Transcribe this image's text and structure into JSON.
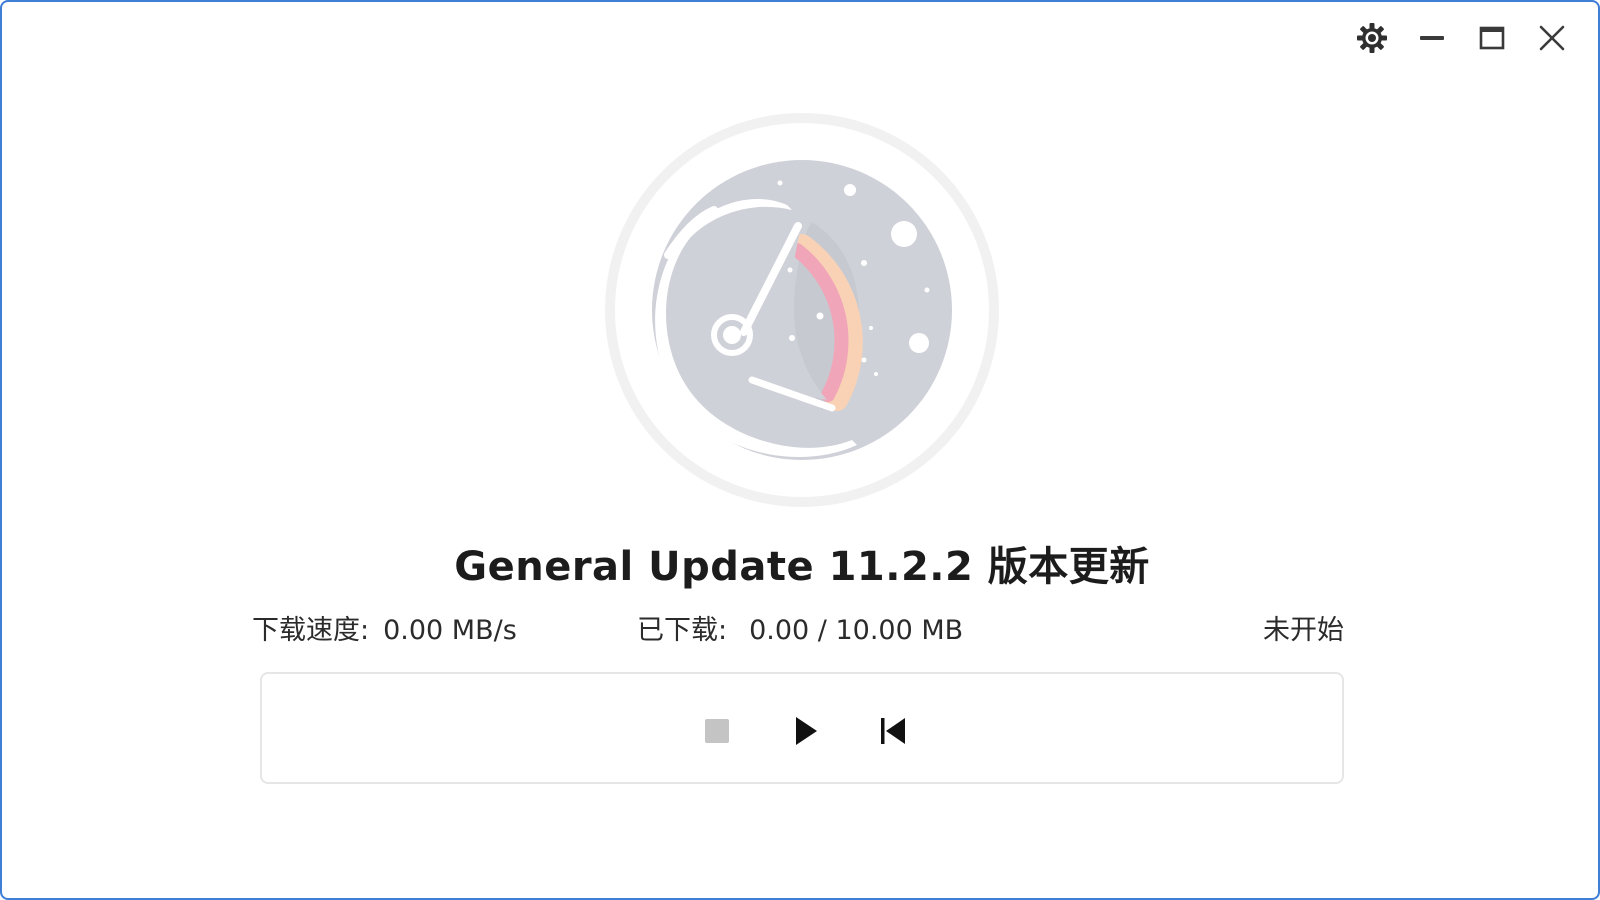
{
  "window": {
    "controls": {
      "settings_icon": "gear-icon",
      "minimize_icon": "minimize-icon",
      "maximize_icon": "maximize-icon",
      "close_icon": "close-icon"
    }
  },
  "header": {
    "title": "General Update 11.2.2 版本更新"
  },
  "stats": {
    "speed_label": "下载速度:",
    "speed_value": "0.00 MB/s",
    "downloaded_label": "已下载:",
    "downloaded_value": "0.00 / 10.00 MB",
    "status": "未开始"
  },
  "player_controls": {
    "stop_icon": "stop-icon",
    "play_icon": "play-icon",
    "restart_icon": "skip-back-icon"
  },
  "colors": {
    "window_border": "#3f7fd6",
    "logo_gray": "#cfd1d8",
    "ring_gray": "#f1f1f1",
    "accent_pink": "#f0a6b8",
    "accent_peach": "#f9d2b6",
    "stop_gray": "#c4c4c4",
    "text_dark": "#1c1c1c"
  }
}
